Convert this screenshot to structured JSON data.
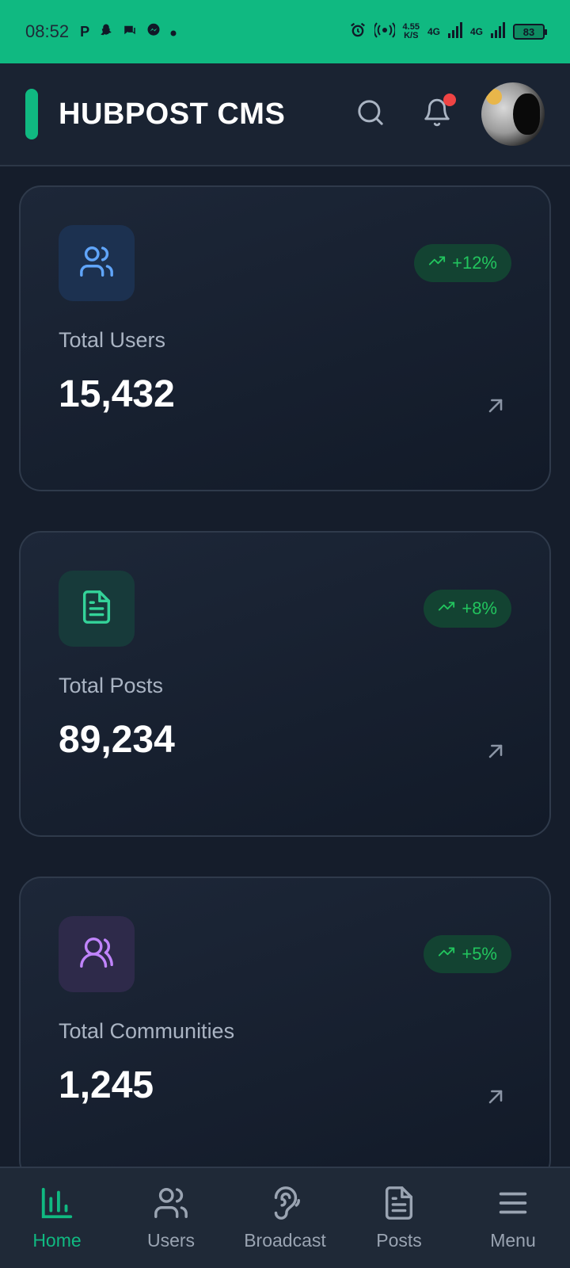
{
  "status_bar": {
    "time": "08:52",
    "speed_top": "4.55",
    "speed_unit": "K/S",
    "net1": "4G",
    "net2": "4G",
    "battery": "83"
  },
  "header": {
    "title": "HUBPOST CMS",
    "accent_color": "#10b981"
  },
  "cards": [
    {
      "label": "Total Users",
      "value": "15,432",
      "trend": "+12%",
      "icon": "users-icon",
      "icon_color": "#60a5fa"
    },
    {
      "label": "Total Posts",
      "value": "89,234",
      "trend": "+8%",
      "icon": "document-icon",
      "icon_color": "#34d399"
    },
    {
      "label": "Total Communities",
      "value": "1,245",
      "trend": "+5%",
      "icon": "communities-icon",
      "icon_color": "#c084fc"
    }
  ],
  "nav": {
    "items": [
      {
        "label": "Home",
        "icon": "bar-chart-icon",
        "active": true
      },
      {
        "label": "Users",
        "icon": "users-icon",
        "active": false
      },
      {
        "label": "Broadcast",
        "icon": "broadcast-icon",
        "active": false
      },
      {
        "label": "Posts",
        "icon": "document-icon",
        "active": false
      },
      {
        "label": "Menu",
        "icon": "menu-icon",
        "active": false
      }
    ]
  }
}
